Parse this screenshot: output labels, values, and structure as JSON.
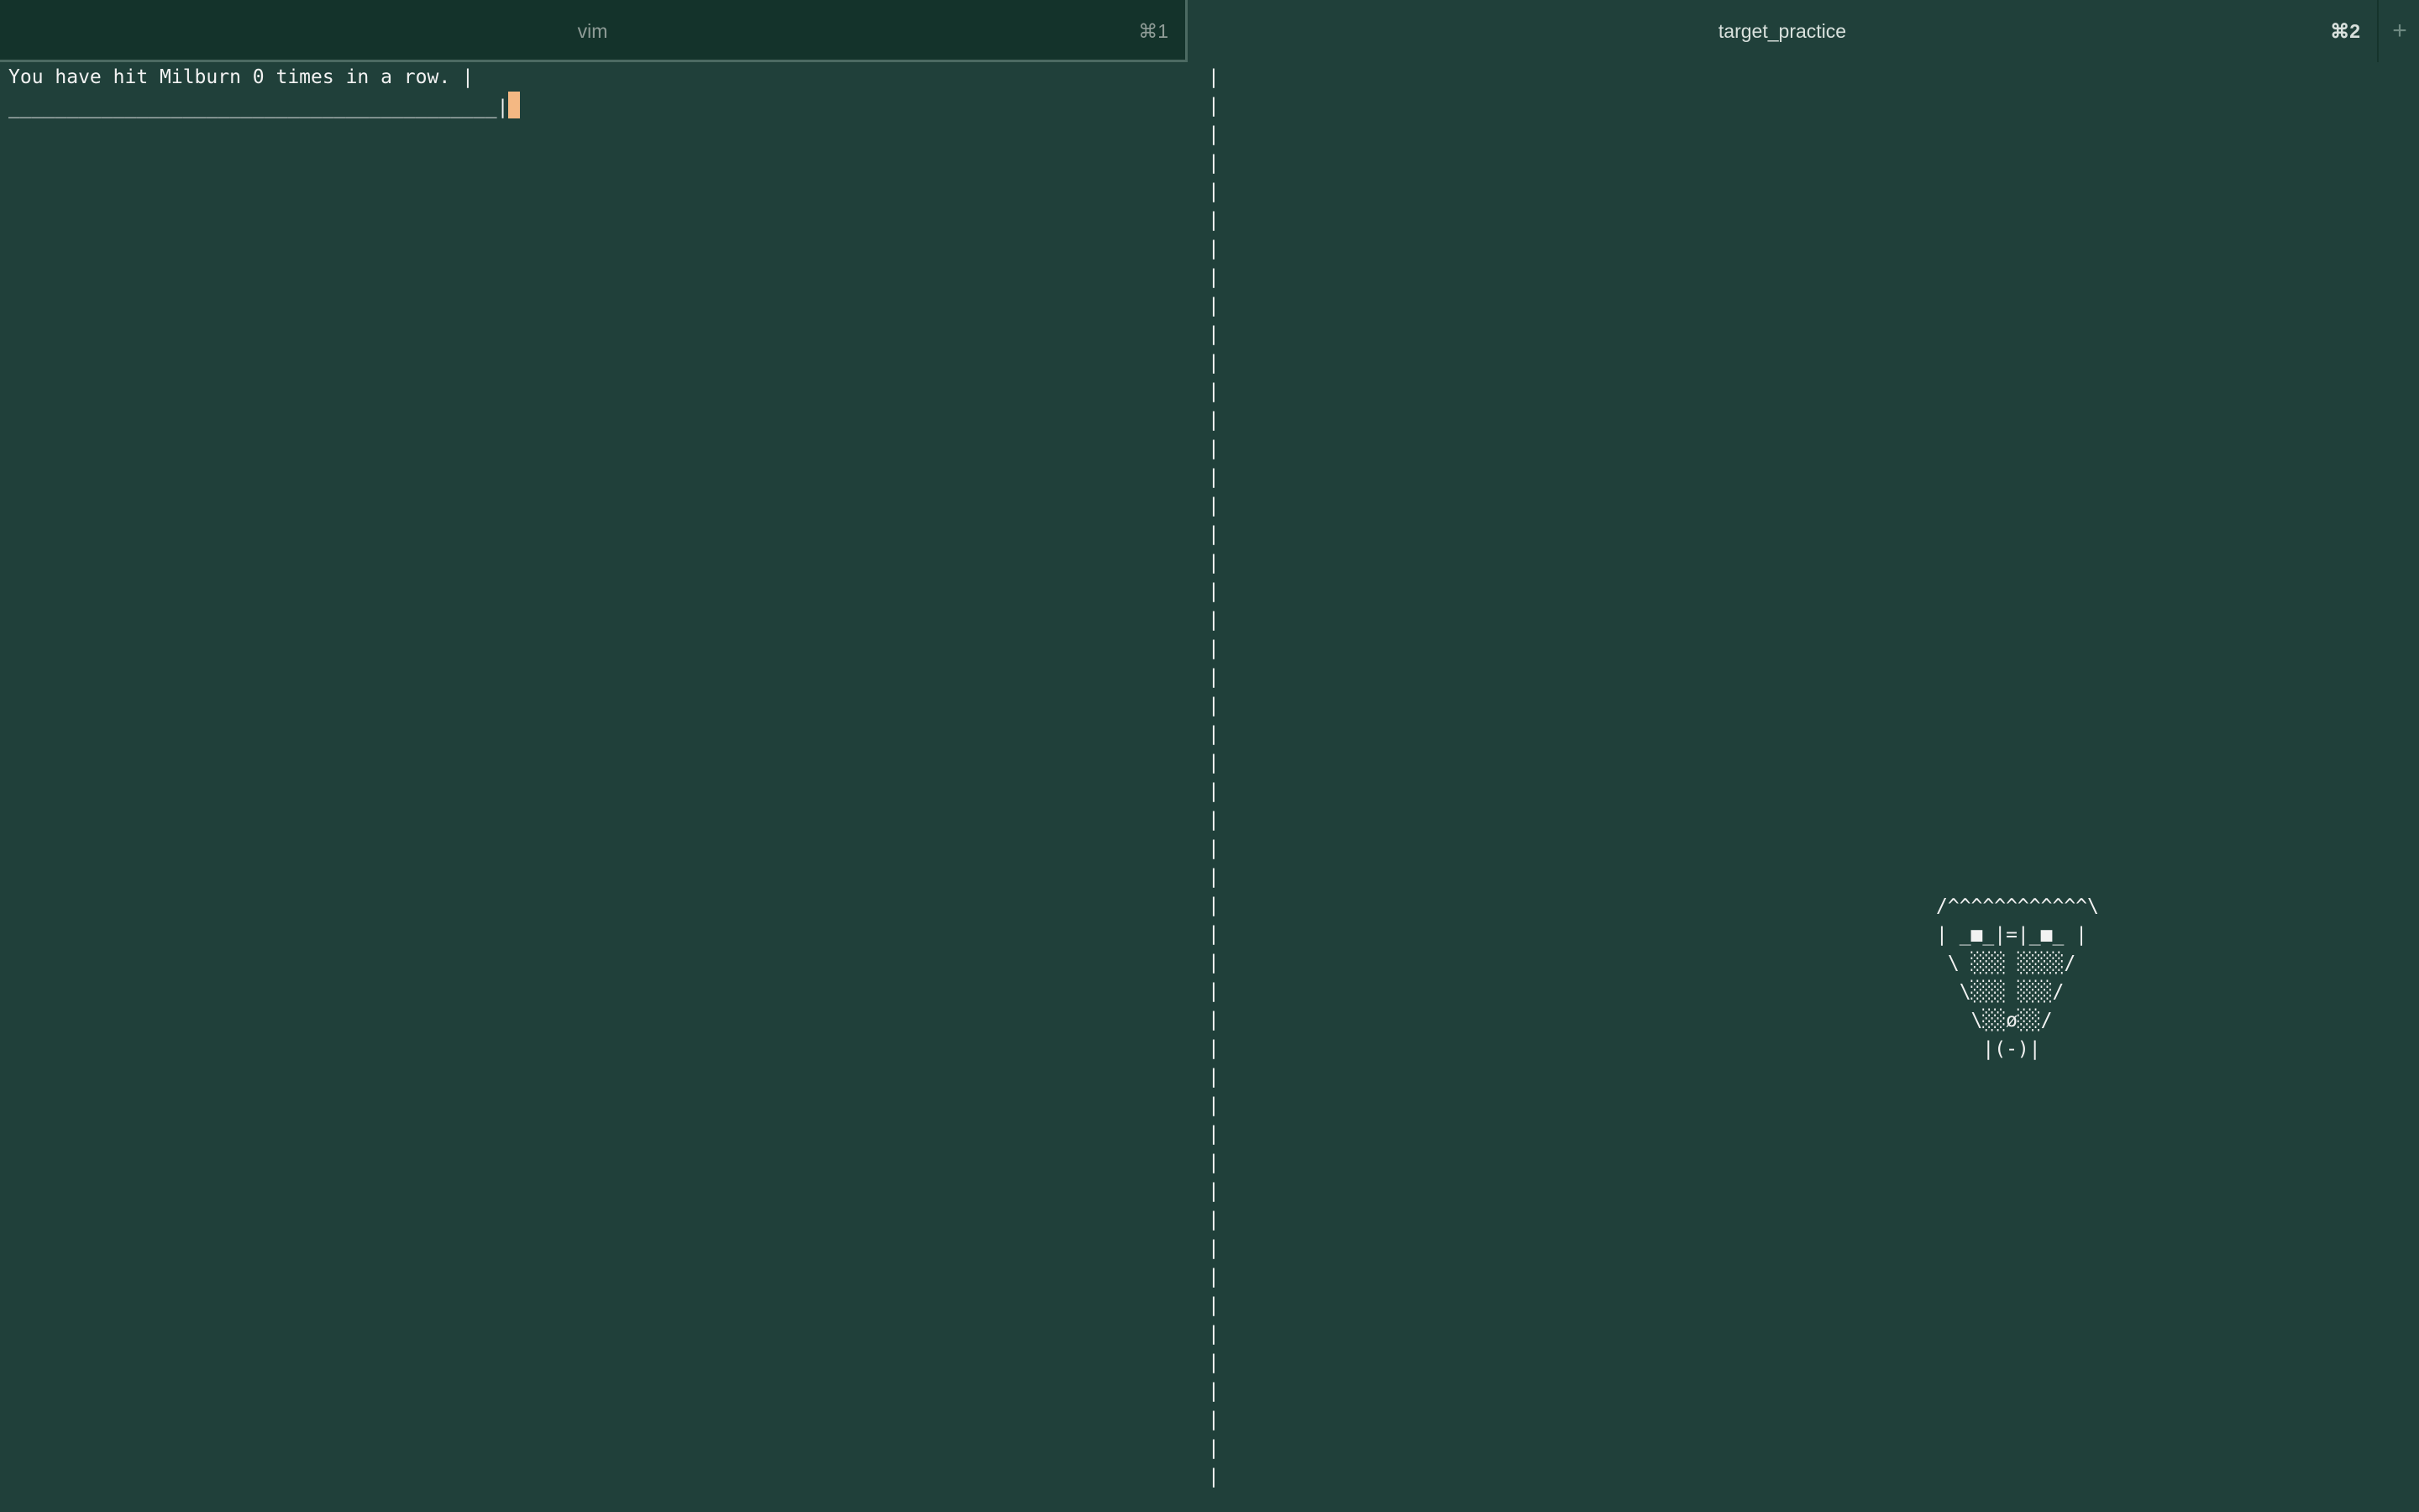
{
  "tabs": [
    {
      "label": "vim",
      "shortcut": "⌘1",
      "active": false
    },
    {
      "label": "target_practice",
      "shortcut": "⌘2",
      "active": true
    }
  ],
  "new_tab_label": "+",
  "left_pane": {
    "line1": "You have hit Milburn 0 times in a row. |",
    "line2": "__________________________________________|"
  },
  "right_pane": {
    "divider_char": "|",
    "face": [
      "/^^^^^^^^^^^^\\",
      "| _■_|=|_■_ |",
      " \\ ░░░ ░░░░/",
      "  \\░░░ ░░░/",
      "   \\░░ø░░/",
      "    |(-)|"
    ]
  },
  "colors": {
    "background": "#20403a",
    "inactive_tab": "#14332b",
    "cursor": "#f4b883"
  }
}
